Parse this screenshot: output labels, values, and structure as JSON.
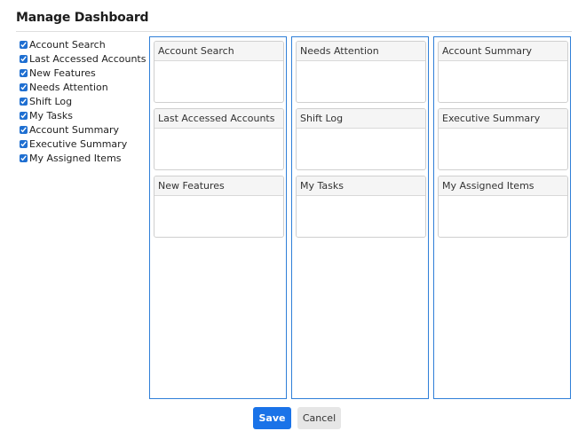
{
  "page": {
    "title": "Manage Dashboard"
  },
  "checklist": {
    "items": [
      {
        "label": "Account Search",
        "checked": true
      },
      {
        "label": "Last Accessed Accounts",
        "checked": true
      },
      {
        "label": "New Features",
        "checked": true
      },
      {
        "label": "Needs Attention",
        "checked": true
      },
      {
        "label": "Shift Log",
        "checked": true
      },
      {
        "label": "My Tasks",
        "checked": true
      },
      {
        "label": "Account Summary",
        "checked": true
      },
      {
        "label": "Executive Summary",
        "checked": true
      },
      {
        "label": "My Assigned Items",
        "checked": true
      }
    ]
  },
  "columns": [
    {
      "widgets": [
        "Account Search",
        "Last Accessed Accounts",
        "New Features"
      ]
    },
    {
      "widgets": [
        "Needs Attention",
        "Shift Log",
        "My Tasks"
      ]
    },
    {
      "widgets": [
        "Account Summary",
        "Executive Summary",
        "My Assigned Items"
      ]
    }
  ],
  "buttons": {
    "save": "Save",
    "cancel": "Cancel"
  },
  "colors": {
    "accent": "#1a73e8",
    "column_border": "#2f7fd8"
  }
}
